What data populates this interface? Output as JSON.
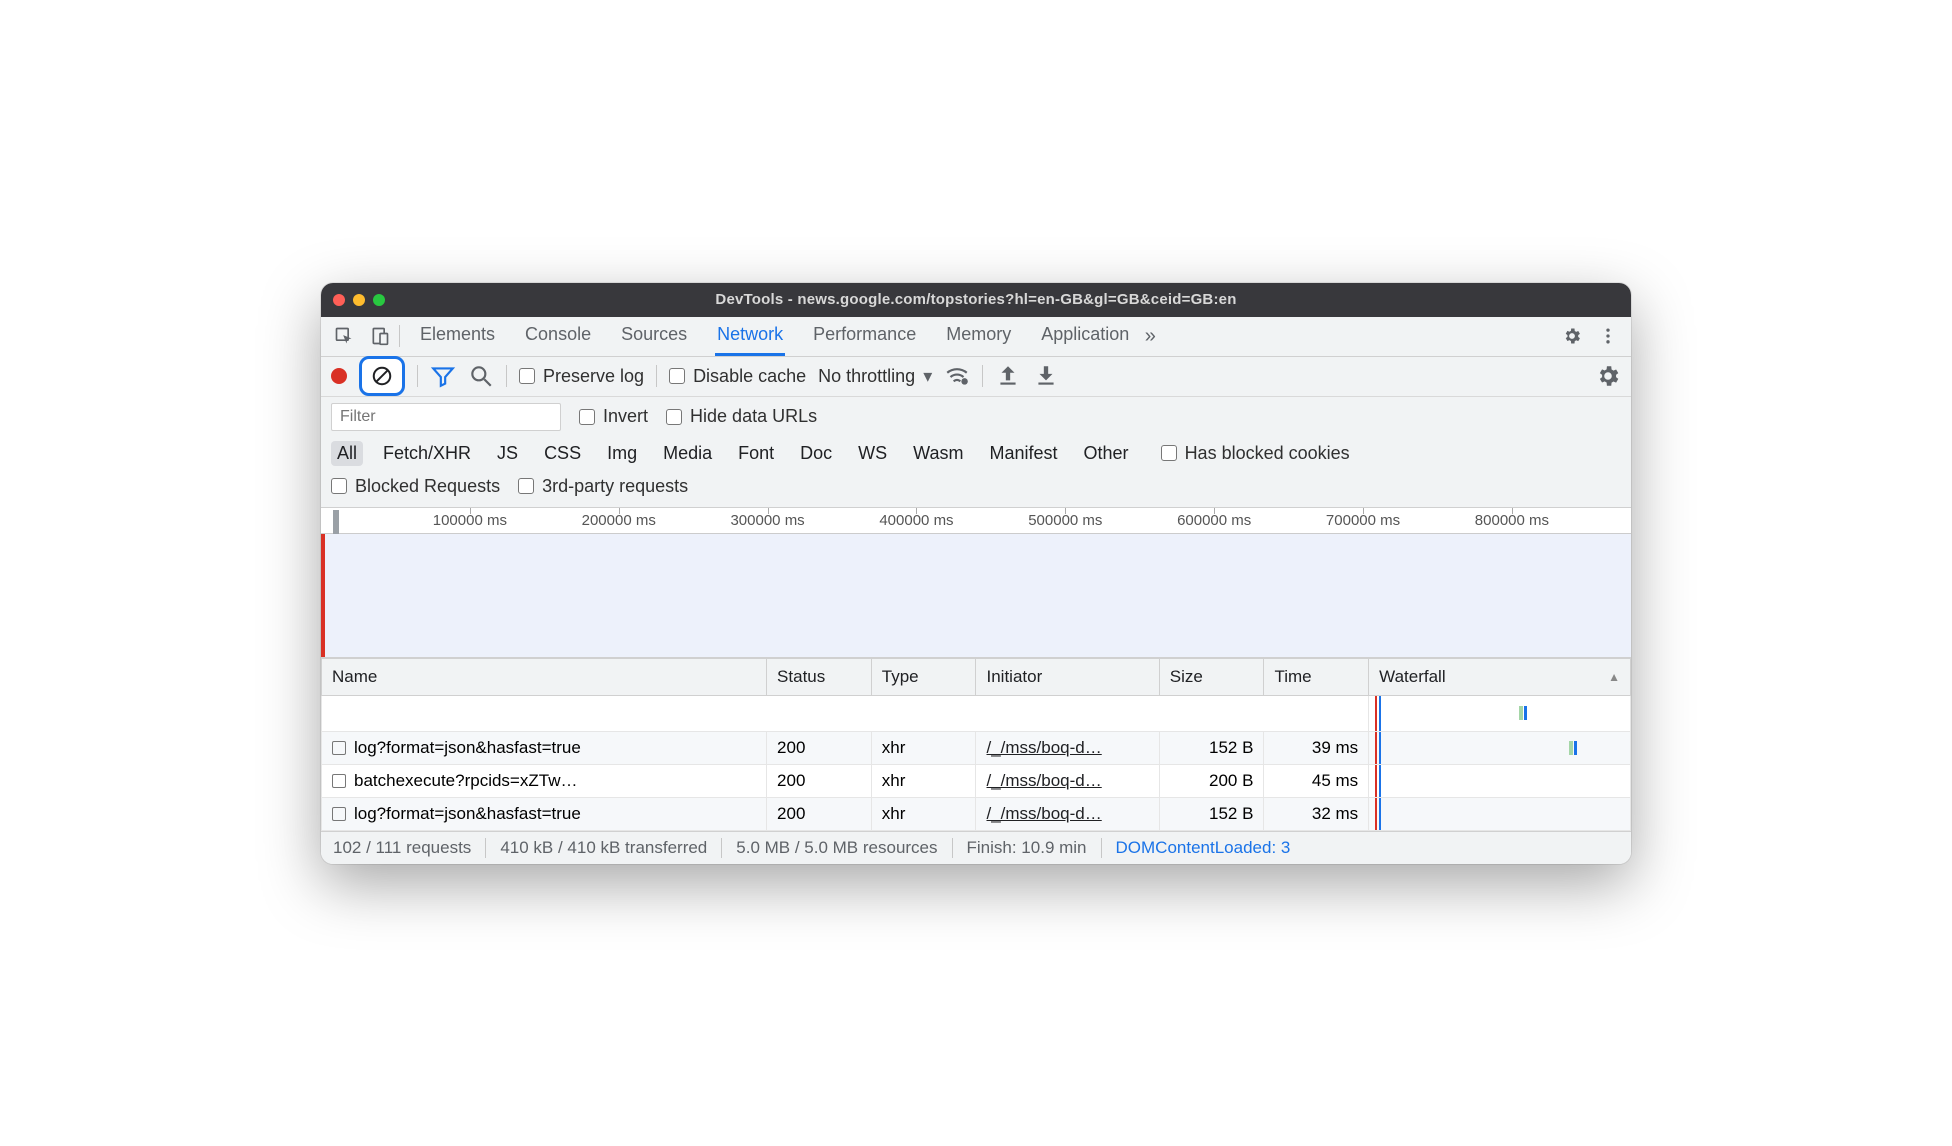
{
  "window": {
    "title": "DevTools - news.google.com/topstories?hl=en-GB&gl=GB&ceid=GB:en"
  },
  "tabs": {
    "items": [
      "Elements",
      "Console",
      "Sources",
      "Network",
      "Performance",
      "Memory",
      "Application"
    ],
    "active": "Network",
    "more_glyph": "»"
  },
  "toolbar": {
    "preserve_log": "Preserve log",
    "disable_cache": "Disable cache",
    "throttling": "No throttling"
  },
  "filter": {
    "placeholder": "Filter",
    "invert": "Invert",
    "hide_data_urls": "Hide data URLs",
    "types": [
      "All",
      "Fetch/XHR",
      "JS",
      "CSS",
      "Img",
      "Media",
      "Font",
      "Doc",
      "WS",
      "Wasm",
      "Manifest",
      "Other"
    ],
    "active_type": "All",
    "has_blocked_cookies": "Has blocked cookies",
    "blocked_requests": "Blocked Requests",
    "third_party": "3rd-party requests"
  },
  "timeline": {
    "ticks": [
      "100000 ms",
      "200000 ms",
      "300000 ms",
      "400000 ms",
      "500000 ms",
      "600000 ms",
      "700000 ms",
      "800000 ms"
    ]
  },
  "table": {
    "columns": {
      "name": "Name",
      "status": "Status",
      "type": "Type",
      "initiator": "Initiator",
      "size": "Size",
      "time": "Time",
      "waterfall": "Waterfall"
    },
    "rows": [
      {
        "name": "log?format=json&hasfast=true",
        "status": "200",
        "type": "xhr",
        "initiator": "/_/mss/boq-d…",
        "size": "152 B",
        "time": "39 ms",
        "wpos": 150
      },
      {
        "name": "batchexecute?rpcids=xZTw…",
        "status": "200",
        "type": "xhr",
        "initiator": "/_/mss/boq-d…",
        "size": "200 B",
        "time": "45 ms",
        "wpos": 0
      },
      {
        "name": "log?format=json&hasfast=true",
        "status": "200",
        "type": "xhr",
        "initiator": "/_/mss/boq-d…",
        "size": "152 B",
        "time": "32 ms",
        "wpos": 0
      }
    ]
  },
  "status": {
    "requests": "102 / 111 requests",
    "transferred": "410 kB / 410 kB transferred",
    "resources": "5.0 MB / 5.0 MB resources",
    "finish": "Finish: 10.9 min",
    "dcl": "DOMContentLoaded: 3"
  }
}
